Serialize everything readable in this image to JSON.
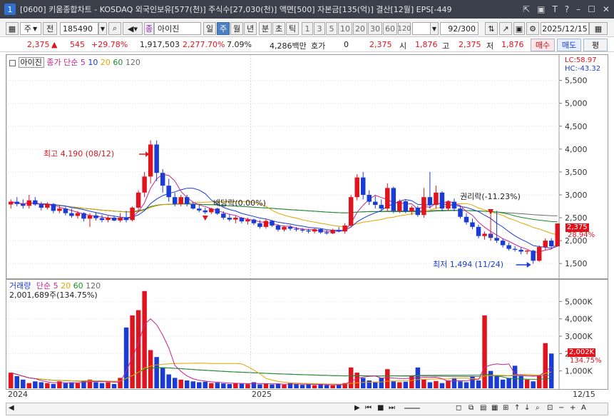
{
  "window": {
    "number": "1",
    "title": "[0600] 키움종합차트 - KOSDAQ 외국인보유[577(천)] 주식수[27,030(천)] 액면[500] 자본금[135(억)] 결산[12월] EPS[-449",
    "controls": [
      "⇱",
      "▣",
      "T",
      "?",
      "–",
      "☐",
      "✕"
    ]
  },
  "toolbar": {
    "period_select": "주",
    "prev_label": "전",
    "code": "185490",
    "search_icon": "search-icon",
    "stock_badge": "종",
    "stock_name": "아이진",
    "periods": [
      "일",
      "주",
      "월",
      "년",
      "분",
      "초",
      "틱"
    ],
    "active_period": "주",
    "intervals": [
      "1",
      "3",
      "5",
      "10",
      "20",
      "30",
      "60",
      "120"
    ],
    "count": "92",
    "total": "/300",
    "date": "2025/12/15"
  },
  "quote": {
    "price": "2,375",
    "change": "545",
    "change_pct": "+29.78%",
    "volume": "1,917,503",
    "volume_pct": "2,277.70%",
    "turnover": "7.09%",
    "amount": "4,286백만",
    "hoga_label": "호가",
    "hoga": "0",
    "hoga_price": "2,375",
    "open_label": "시",
    "open": "1,876",
    "high_label": "고",
    "high": "2,375",
    "low_label": "저",
    "low": "1,876",
    "buy_label": "매수",
    "sell_label": "매도",
    "avg_label": "평"
  },
  "price_panel": {
    "name_tag": "아이진",
    "legend_base": "종가 단순",
    "ma_labels": [
      "5",
      "10",
      "20",
      "60",
      "120"
    ],
    "lc_label": "LC:58.97",
    "hc_label": "HC:-43.32",
    "last_price_tag": "2,375",
    "last_pct_tag": "28.94%",
    "annotations": {
      "high": "최고 4,190 (08/12)",
      "dividend": "배당락(0.00%)",
      "rights": "권리락(-11.23%)",
      "low": "최저 1,494 (11/24)"
    },
    "y_ticks": [
      "5,500",
      "5,000",
      "4,500",
      "4,000",
      "3,500",
      "3,000",
      "2,500",
      "2,000",
      "1,500"
    ]
  },
  "volume_panel": {
    "legend_base": "거래량",
    "legend_ma": "단순",
    "ma_labels": [
      "5",
      "20",
      "60",
      "120"
    ],
    "total": "2,001,689주(134.75%)",
    "last_vol_tag": "2,002K",
    "last_pct_tag": "134.75%",
    "y_ticks": [
      "5,000K",
      "4,000K",
      "3,000K",
      "2,000K",
      "1,000K"
    ]
  },
  "x_axis": {
    "labels": [
      "2024",
      "2025"
    ],
    "end_label": "12/15"
  },
  "colors": {
    "up": "#e0141e",
    "down": "#1a3bd4",
    "ma5": "#c8238c",
    "ma10": "#1a3bd4",
    "ma20": "#e2a400",
    "ma60": "#1a8c2a",
    "ma120": "#6a6a6a"
  },
  "chart_data": [
    {
      "type": "candlestick",
      "title": "",
      "ylabel": "",
      "ylim": [
        1300,
        5900
      ],
      "x_start": "2024-01",
      "x_end": "2025-12-15",
      "markers": {
        "high": 4190,
        "low": 1494,
        "last": 2375
      },
      "candles": [
        {
          "o": 2790,
          "h": 2900,
          "l": 2700,
          "c": 2850
        },
        {
          "o": 2850,
          "h": 2950,
          "l": 2750,
          "c": 2800
        },
        {
          "o": 2800,
          "h": 2900,
          "l": 2700,
          "c": 2760
        },
        {
          "o": 2760,
          "h": 3000,
          "l": 2700,
          "c": 2880
        },
        {
          "o": 2880,
          "h": 2950,
          "l": 2760,
          "c": 2790
        },
        {
          "o": 2790,
          "h": 2850,
          "l": 2660,
          "c": 2720
        },
        {
          "o": 2720,
          "h": 2840,
          "l": 2680,
          "c": 2800
        },
        {
          "o": 2800,
          "h": 2820,
          "l": 2600,
          "c": 2650
        },
        {
          "o": 2650,
          "h": 2760,
          "l": 2600,
          "c": 2700
        },
        {
          "o": 2700,
          "h": 2740,
          "l": 2550,
          "c": 2600
        },
        {
          "o": 2600,
          "h": 2700,
          "l": 2500,
          "c": 2540
        },
        {
          "o": 2540,
          "h": 2650,
          "l": 2480,
          "c": 2600
        },
        {
          "o": 2600,
          "h": 2620,
          "l": 2420,
          "c": 2480
        },
        {
          "o": 2480,
          "h": 2600,
          "l": 2300,
          "c": 2550
        },
        {
          "o": 2550,
          "h": 2620,
          "l": 2440,
          "c": 2490
        },
        {
          "o": 2490,
          "h": 2560,
          "l": 2400,
          "c": 2450
        },
        {
          "o": 2450,
          "h": 2540,
          "l": 2400,
          "c": 2500
        },
        {
          "o": 2500,
          "h": 2540,
          "l": 2420,
          "c": 2440
        },
        {
          "o": 2440,
          "h": 2600,
          "l": 2400,
          "c": 2500
        },
        {
          "o": 2500,
          "h": 2650,
          "l": 2400,
          "c": 2450
        },
        {
          "o": 2450,
          "h": 2750,
          "l": 2420,
          "c": 2720
        },
        {
          "o": 2720,
          "h": 3100,
          "l": 2650,
          "c": 3050
        },
        {
          "o": 3050,
          "h": 3500,
          "l": 2950,
          "c": 3400
        },
        {
          "o": 3400,
          "h": 4190,
          "l": 3250,
          "c": 4100
        },
        {
          "o": 4100,
          "h": 4190,
          "l": 3300,
          "c": 3480
        },
        {
          "o": 3480,
          "h": 3560,
          "l": 3050,
          "c": 3200
        },
        {
          "o": 3200,
          "h": 3350,
          "l": 2850,
          "c": 2950
        },
        {
          "o": 2950,
          "h": 3050,
          "l": 2750,
          "c": 2800
        },
        {
          "o": 2800,
          "h": 3000,
          "l": 2750,
          "c": 2950
        },
        {
          "o": 2950,
          "h": 3000,
          "l": 2750,
          "c": 2800
        },
        {
          "o": 2800,
          "h": 2840,
          "l": 2680,
          "c": 2700
        },
        {
          "o": 2700,
          "h": 2780,
          "l": 2620,
          "c": 2660
        },
        {
          "o": 2660,
          "h": 2720,
          "l": 2580,
          "c": 2620
        },
        {
          "o": 2620,
          "h": 2720,
          "l": 2580,
          "c": 2700
        },
        {
          "o": 2700,
          "h": 2720,
          "l": 2560,
          "c": 2590
        },
        {
          "o": 2590,
          "h": 2640,
          "l": 2460,
          "c": 2500
        },
        {
          "o": 2500,
          "h": 2580,
          "l": 2420,
          "c": 2460
        },
        {
          "o": 2460,
          "h": 2540,
          "l": 2380,
          "c": 2500
        },
        {
          "o": 2500,
          "h": 2520,
          "l": 2380,
          "c": 2420
        },
        {
          "o": 2420,
          "h": 2500,
          "l": 2350,
          "c": 2460
        },
        {
          "o": 2460,
          "h": 2480,
          "l": 2340,
          "c": 2380
        },
        {
          "o": 2380,
          "h": 2450,
          "l": 2260,
          "c": 2300
        },
        {
          "o": 2300,
          "h": 2480,
          "l": 2260,
          "c": 2430
        },
        {
          "o": 2430,
          "h": 2450,
          "l": 2300,
          "c": 2330
        },
        {
          "o": 2330,
          "h": 2360,
          "l": 2200,
          "c": 2240
        },
        {
          "o": 2240,
          "h": 2320,
          "l": 2200,
          "c": 2300
        },
        {
          "o": 2300,
          "h": 2340,
          "l": 2220,
          "c": 2260
        },
        {
          "o": 2260,
          "h": 2300,
          "l": 2200,
          "c": 2240
        },
        {
          "o": 2240,
          "h": 2280,
          "l": 2180,
          "c": 2220
        },
        {
          "o": 2220,
          "h": 2260,
          "l": 2160,
          "c": 2200
        },
        {
          "o": 2200,
          "h": 2280,
          "l": 2160,
          "c": 2250
        },
        {
          "o": 2250,
          "h": 2270,
          "l": 2150,
          "c": 2180
        },
        {
          "o": 2180,
          "h": 2230,
          "l": 2130,
          "c": 2160
        },
        {
          "o": 2160,
          "h": 2260,
          "l": 2140,
          "c": 2230
        },
        {
          "o": 2230,
          "h": 2300,
          "l": 2180,
          "c": 2200
        },
        {
          "o": 2200,
          "h": 2380,
          "l": 2150,
          "c": 2330
        },
        {
          "o": 2330,
          "h": 3000,
          "l": 2300,
          "c": 2950
        },
        {
          "o": 2950,
          "h": 3450,
          "l": 2880,
          "c": 3380
        },
        {
          "o": 3380,
          "h": 3500,
          "l": 2900,
          "c": 3000
        },
        {
          "o": 3000,
          "h": 3100,
          "l": 2780,
          "c": 2850
        },
        {
          "o": 2850,
          "h": 2980,
          "l": 2700,
          "c": 2780
        },
        {
          "o": 2780,
          "h": 2900,
          "l": 2650,
          "c": 2700
        },
        {
          "o": 2700,
          "h": 3250,
          "l": 2650,
          "c": 3150
        },
        {
          "o": 3150,
          "h": 3180,
          "l": 2600,
          "c": 2650
        },
        {
          "o": 2650,
          "h": 2900,
          "l": 2600,
          "c": 2860
        },
        {
          "o": 2860,
          "h": 2900,
          "l": 2600,
          "c": 2640
        },
        {
          "o": 2640,
          "h": 2760,
          "l": 2560,
          "c": 2720
        },
        {
          "o": 2720,
          "h": 2760,
          "l": 2520,
          "c": 2560
        },
        {
          "o": 2560,
          "h": 3150,
          "l": 2500,
          "c": 2950
        },
        {
          "o": 2950,
          "h": 3500,
          "l": 2700,
          "c": 2780
        },
        {
          "o": 2780,
          "h": 3200,
          "l": 2700,
          "c": 3050
        },
        {
          "o": 3050,
          "h": 3080,
          "l": 2650,
          "c": 2700
        },
        {
          "o": 2700,
          "h": 2880,
          "l": 2650,
          "c": 2850
        },
        {
          "o": 2850,
          "h": 2920,
          "l": 2640,
          "c": 2700
        },
        {
          "o": 2700,
          "h": 2760,
          "l": 2480,
          "c": 2520
        },
        {
          "o": 2520,
          "h": 2600,
          "l": 2350,
          "c": 2400
        },
        {
          "o": 2400,
          "h": 2480,
          "l": 2250,
          "c": 2300
        },
        {
          "o": 2300,
          "h": 2350,
          "l": 2050,
          "c": 2100
        },
        {
          "o": 2100,
          "h": 2200,
          "l": 2020,
          "c": 2150
        },
        {
          "o": 2150,
          "h": 2200,
          "l": 2000,
          "c": 2060
        },
        {
          "o": 2060,
          "h": 2650,
          "l": 1950,
          "c": 2000
        },
        {
          "o": 2000,
          "h": 2050,
          "l": 1850,
          "c": 1900
        },
        {
          "o": 1900,
          "h": 1960,
          "l": 1780,
          "c": 1820
        },
        {
          "o": 1820,
          "h": 1880,
          "l": 1760,
          "c": 1800
        },
        {
          "o": 1800,
          "h": 1850,
          "l": 1700,
          "c": 1760
        },
        {
          "o": 1760,
          "h": 1800,
          "l": 1700,
          "c": 1780
        },
        {
          "o": 1780,
          "h": 1800,
          "l": 1494,
          "c": 1560
        },
        {
          "o": 1560,
          "h": 1900,
          "l": 1540,
          "c": 1860
        },
        {
          "o": 1860,
          "h": 2050,
          "l": 1800,
          "c": 2000
        },
        {
          "o": 2000,
          "h": 2050,
          "l": 1830,
          "c": 1876
        },
        {
          "o": 1876,
          "h": 2375,
          "l": 1876,
          "c": 2375
        }
      ]
    },
    {
      "type": "bar",
      "title": "",
      "ylabel": "",
      "ylim": [
        0,
        6000000
      ],
      "values": [
        900000,
        700000,
        500000,
        300000,
        400000,
        350000,
        300000,
        250000,
        400000,
        300000,
        350000,
        300000,
        450000,
        500000,
        350000,
        300000,
        350000,
        250000,
        600000,
        3500000,
        4200000,
        4500000,
        5600000,
        2200000,
        1800000,
        1200000,
        800000,
        600000,
        500000,
        450000,
        400000,
        350000,
        380000,
        300000,
        320000,
        280000,
        250000,
        300000,
        260000,
        240000,
        350000,
        230000,
        250000,
        220000,
        260000,
        210000,
        300000,
        240000,
        200000,
        220000,
        180000,
        250000,
        190000,
        170000,
        220000,
        300000,
        1200000,
        900000,
        600000,
        450000,
        380000,
        600000,
        1100000,
        400000,
        350000,
        380000,
        700000,
        1200000,
        500000,
        350000,
        420000,
        300000,
        450000,
        600000,
        400000,
        350000,
        700000,
        450000,
        4200000,
        1000000,
        700000,
        500000,
        600000,
        1300000,
        700000,
        500000,
        400000,
        700000,
        2600000,
        2002000
      ]
    }
  ]
}
